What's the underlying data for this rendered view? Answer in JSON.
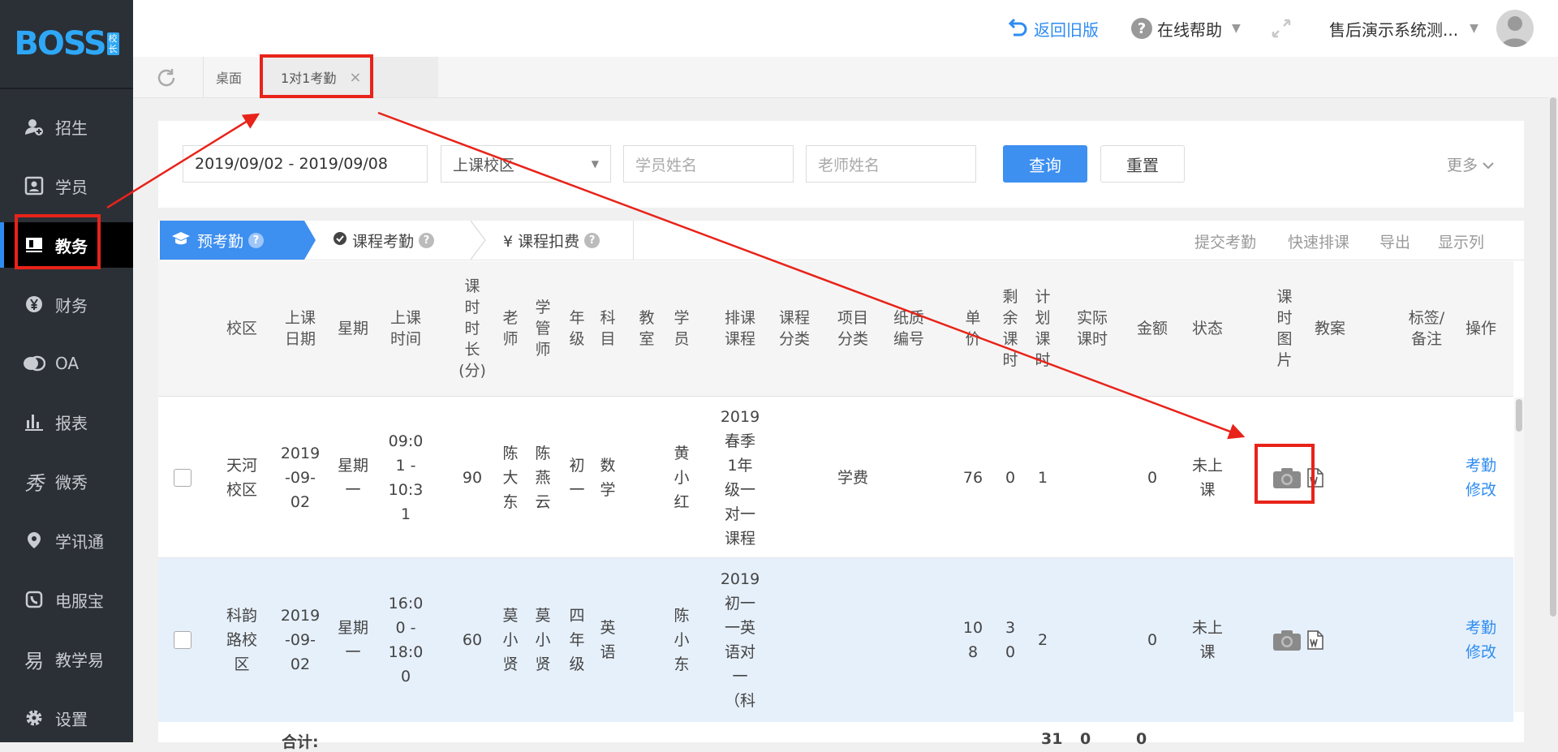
{
  "sidebar": {
    "logo_text": "BOSS",
    "logo_badge": [
      "校",
      "长"
    ],
    "items": [
      {
        "label": "招生",
        "icon": "user-add-icon"
      },
      {
        "label": "学员",
        "icon": "id-card-icon"
      },
      {
        "label": "教务",
        "icon": "book-icon"
      },
      {
        "label": "财务",
        "icon": "yen-coin-icon"
      },
      {
        "label": "OA",
        "icon": "chat-bubbles-icon"
      },
      {
        "label": "报表",
        "icon": "bar-chart-icon"
      },
      {
        "label": "微秀",
        "icon": "xiu-icon"
      },
      {
        "label": "学讯通",
        "icon": "location-pin-icon"
      },
      {
        "label": "电服宝",
        "icon": "phone-icon"
      },
      {
        "label": "教学易",
        "icon": "yi-icon"
      },
      {
        "label": "设置",
        "icon": "gear-icon"
      }
    ]
  },
  "topbar": {
    "back_old": "返回旧版",
    "help": "在线帮助",
    "user": "售后演示系统测..."
  },
  "tabs": {
    "desk": "桌面",
    "attendance": "1对1考勤",
    "close": "×"
  },
  "filter": {
    "date_range": "2019/09/02 - 2019/09/08",
    "campus_placeholder": "上课校区",
    "student_placeholder": "学员姓名",
    "teacher_placeholder": "老师姓名",
    "query": "查询",
    "reset": "重置",
    "more": "更多"
  },
  "subtabs": {
    "pre": "预考勤",
    "course": "课程考勤",
    "fee": "¥ 课程扣费",
    "actions": [
      "提交考勤",
      "快速排课",
      "导出",
      "显示列"
    ]
  },
  "columns": [
    "校区",
    "上课\n日期",
    "星期",
    "上课\n时间",
    "课\n时\n时\n长\n(分)",
    "老\n师",
    "学\n管\n师",
    "年\n级",
    "科\n目",
    "教\n室",
    "学\n员",
    "排课\n课程",
    "课程\n分类",
    "项目\n分类",
    "纸质\n编号",
    "单\n价",
    "剩\n余\n课\n时",
    "计\n划\n课\n时",
    "实际\n课时",
    "金额",
    "状态",
    "课\n时\n图\n片",
    "教案",
    "标签/\n备注",
    "操作"
  ],
  "rows": [
    {
      "campus": "天河\n校区",
      "date": "2019\n-09-\n02",
      "weekday": "星期\n一",
      "time": "09:0\n1 -\n10:3\n1",
      "duration": "90",
      "teacher": "陈\n大\n东",
      "manager": "陈\n燕\n云",
      "grade": "初\n一",
      "subject": "数\n学",
      "room": "",
      "student": "黄\n小\n红",
      "course": "2019\n春季\n1年\n级一\n对一\n课程",
      "course_type": "",
      "project": "学费",
      "paper_no": "",
      "price": "76",
      "remaining": "0",
      "planned": "1",
      "actual": "",
      "amount": "0",
      "status": "未上\n课",
      "op": "考勤\n修改"
    },
    {
      "campus": "科韵\n路校\n区",
      "date": "2019\n-09-\n02",
      "weekday": "星期\n一",
      "time": "16:0\n0 -\n18:0\n0",
      "duration": "60",
      "teacher": "莫\n小\n贤",
      "manager": "莫\n小\n贤",
      "grade": "四\n年\n级",
      "subject": "英\n语",
      "room": "",
      "student": "陈\n小\n东",
      "course": "2019\n初一\n一英\n语对\n一\n（科",
      "course_type": "",
      "project": "",
      "paper_no": "",
      "price": "10\n8",
      "remaining": "3\n0",
      "planned": "2",
      "actual": "",
      "amount": "0",
      "status": "未上\n课",
      "op": "考勤\n修改"
    }
  ],
  "footer": {
    "total_label": "合计:",
    "planned_total": "31",
    "actual_total": "0",
    "amount_total": "0"
  },
  "colors": {
    "accent": "#2e8cf0",
    "sidebar": "#2b3036",
    "annotation": "#e8231a"
  }
}
